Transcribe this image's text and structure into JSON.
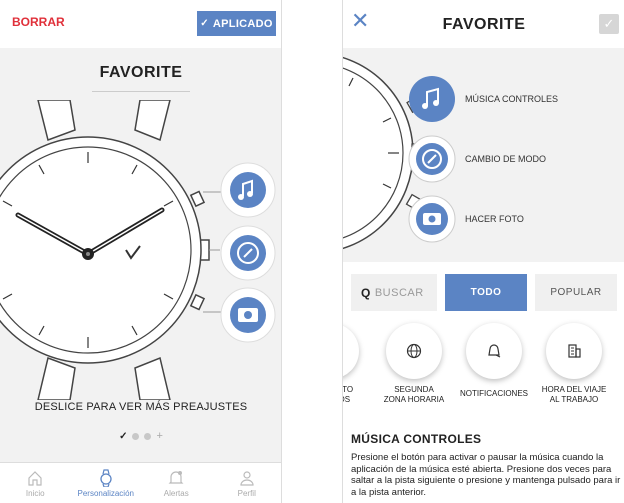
{
  "left": {
    "borrar_label": "BORRAR",
    "applied_label": "APLICADO",
    "title": "FAVORITE",
    "swipe_text": "DESLICE PARA VER MÁS PREAJUSTES",
    "tabs": [
      {
        "label": "Inicio",
        "icon": "home-icon"
      },
      {
        "label": "Personalización",
        "icon": "watch-icon"
      },
      {
        "label": "Alertas",
        "icon": "bell-icon"
      },
      {
        "label": "Perfil",
        "icon": "person-icon"
      }
    ],
    "active_tab": 1
  },
  "right": {
    "title": "FAVORITE",
    "complications": [
      {
        "label": "MÚSICA CONTROLES",
        "icon": "music-icon"
      },
      {
        "label": "CAMBIO DE MODO",
        "icon": "mode-dial-icon"
      },
      {
        "label": "HACER FOTO",
        "icon": "camera-icon"
      }
    ],
    "search_label": "BUSCAR",
    "segment_all": "TODO",
    "segment_popular": "POPULAR",
    "carousel": [
      {
        "label_1": "ENTO",
        "label_2": "IVOS",
        "icon": "steps-icon"
      },
      {
        "label_1": "SEGUNDA",
        "label_2": "ZONA HORARIA",
        "icon": "globe-icon"
      },
      {
        "label_1": "NOTIFICACIONES",
        "label_2": "",
        "icon": "notification-icon"
      },
      {
        "label_1": "HORA DEL VIAJE",
        "label_2": "AL TRABAJO",
        "icon": "building-icon"
      }
    ],
    "description_title": "MÚSICA CONTROLES",
    "description_body": "Presione el botón para activar o pausar la música cuando la aplicación de la música esté abierta. Presione dos veces para saltar a la pista siguiente o presione y mantenga pulsado para ir a la pista anterior."
  },
  "colors": {
    "accent": "#5b84c4",
    "danger": "#e0303a",
    "background": "#f2f2f2"
  }
}
